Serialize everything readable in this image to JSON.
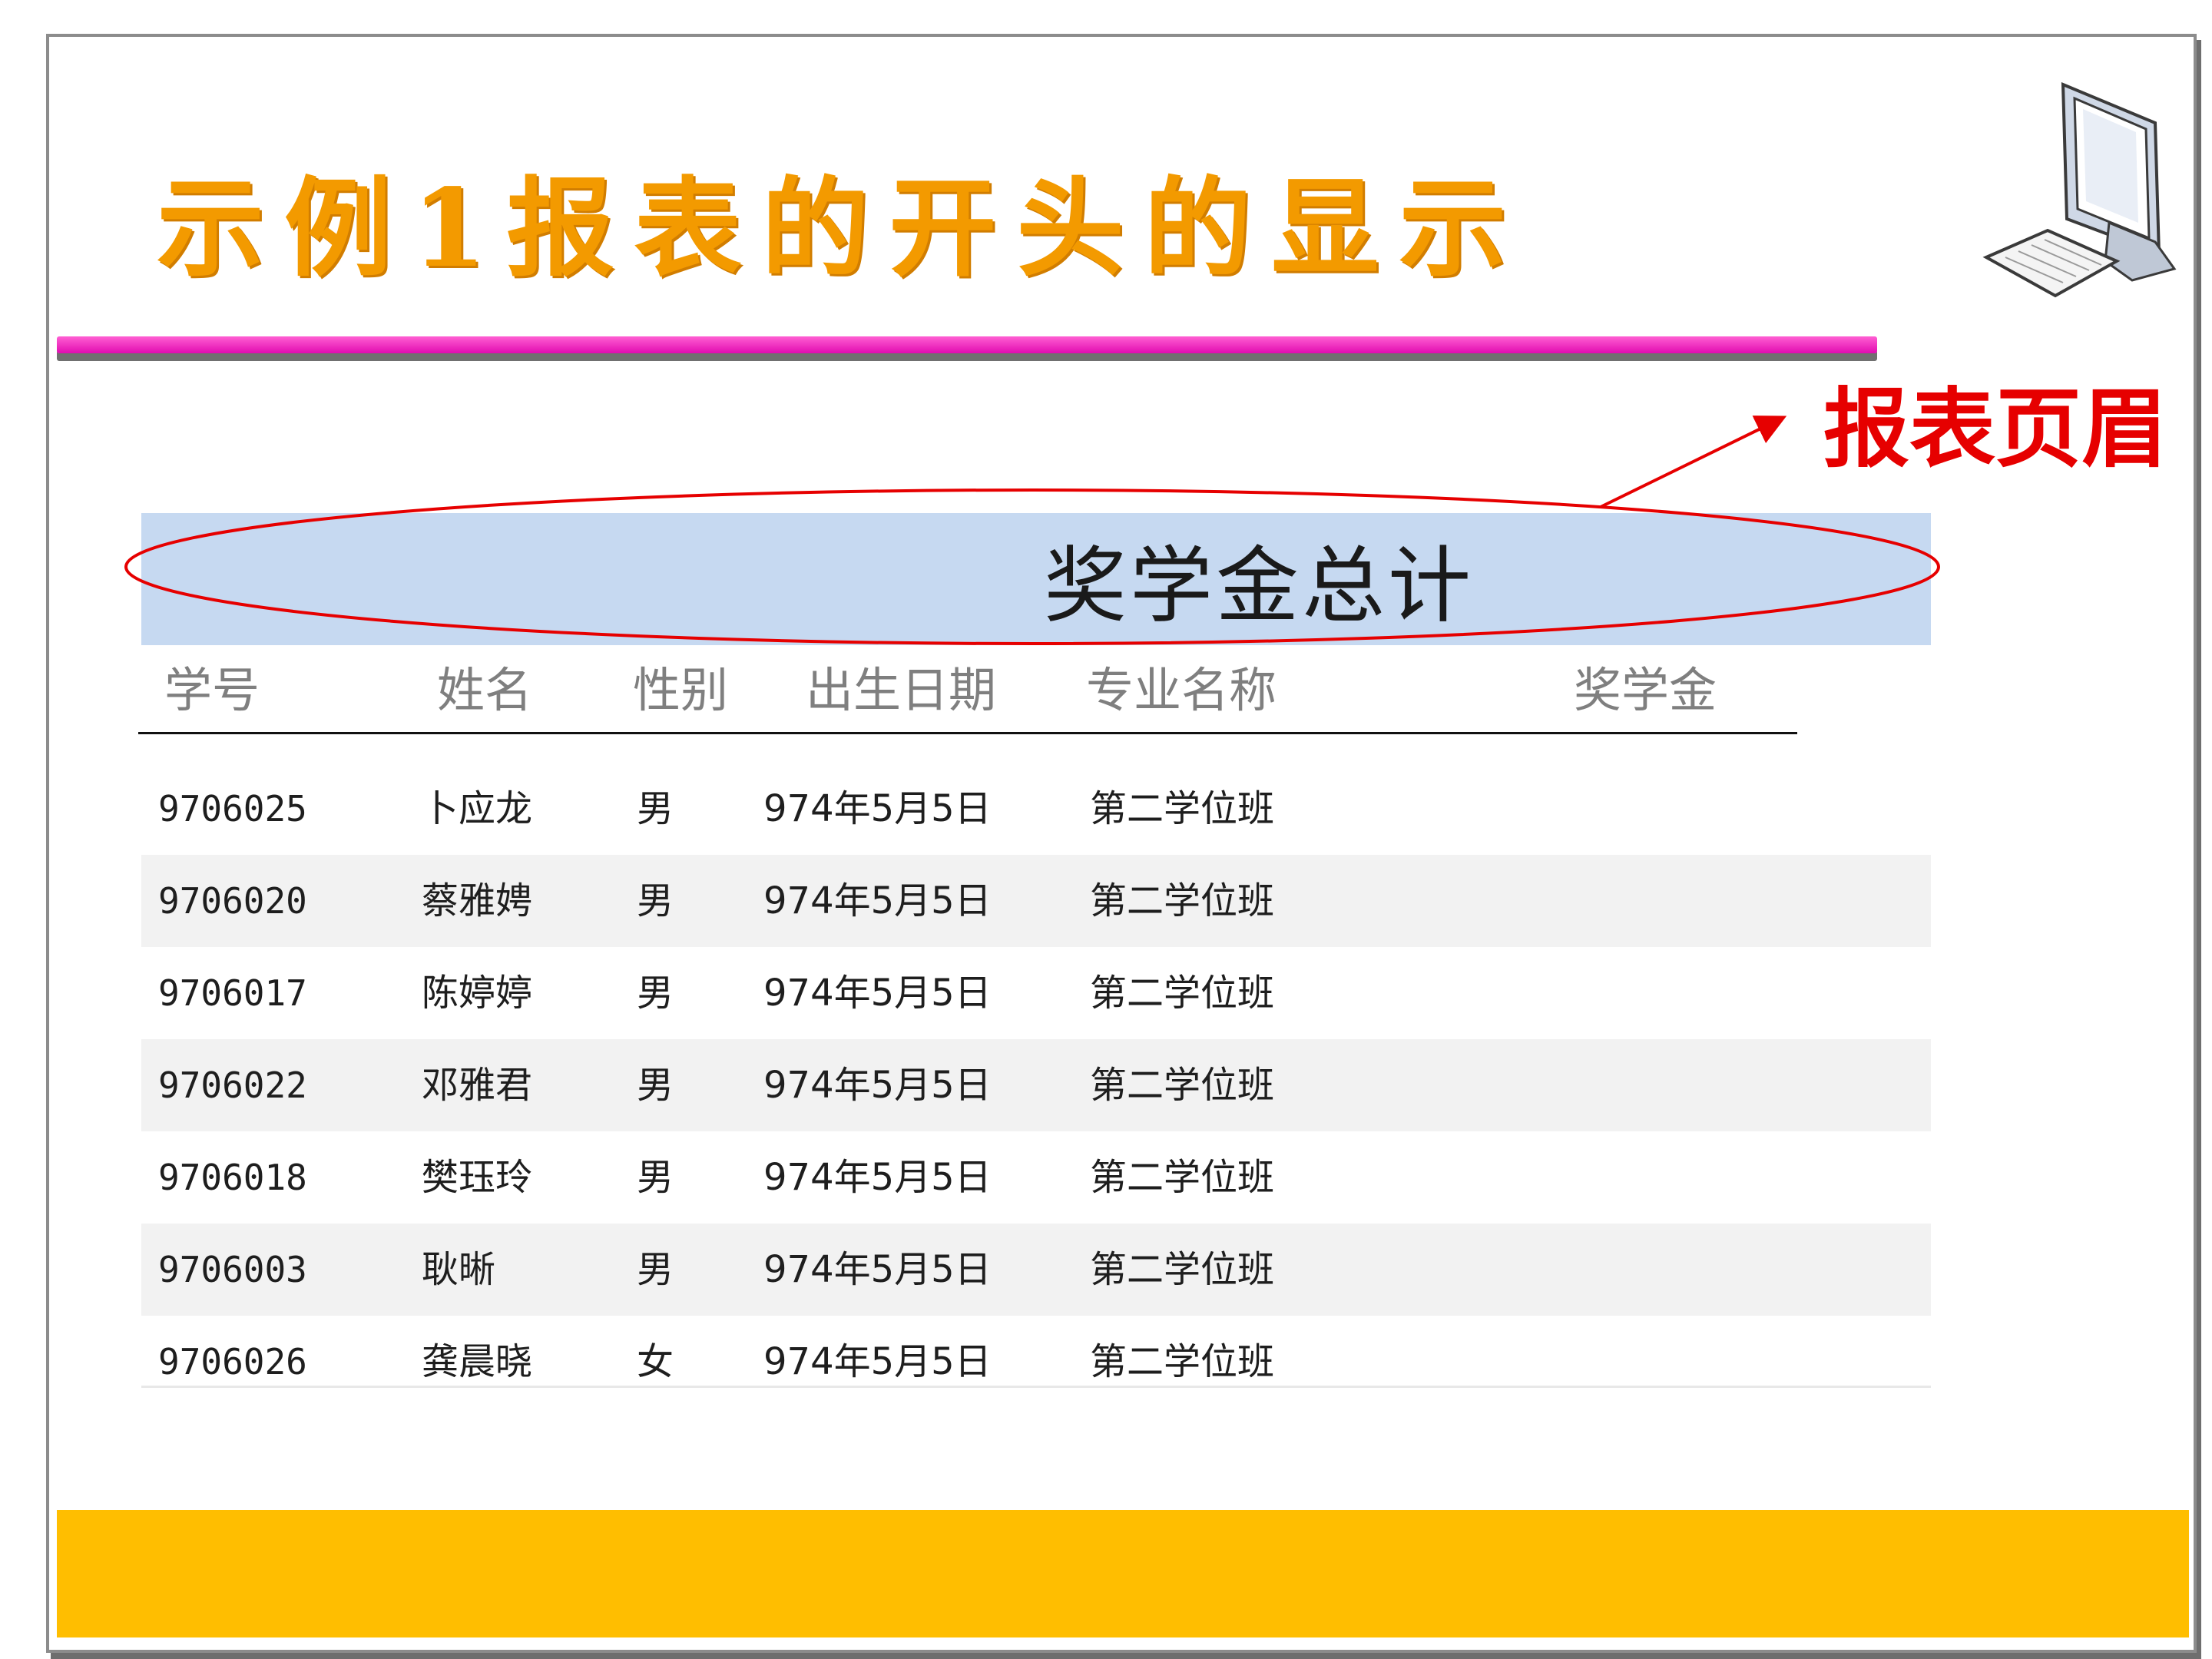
{
  "slide_title": "示例1报表的开头的显示",
  "annotation": {
    "label": "报表页眉",
    "color": "#e60000"
  },
  "report": {
    "title": "奖学金总计",
    "header_bg": "#c6d9f1",
    "columns": [
      "学号",
      "姓名",
      "性别",
      "出生日期",
      "专业名称",
      "奖学金"
    ],
    "rows": [
      [
        "9706025",
        "卜应龙",
        "男",
        "974年5月5日",
        "第二学位班",
        ""
      ],
      [
        "9706020",
        "蔡雅娉",
        "男",
        "974年5月5日",
        "第二学位班",
        ""
      ],
      [
        "9706017",
        "陈婷婷",
        "男",
        "974年5月5日",
        "第二学位班",
        ""
      ],
      [
        "9706022",
        "邓雅君",
        "男",
        "974年5月5日",
        "第二学位班",
        ""
      ],
      [
        "9706018",
        "樊珏玲",
        "男",
        "974年5月5日",
        "第二学位班",
        ""
      ],
      [
        "9706003",
        "耿晰",
        "男",
        "974年5月5日",
        "第二学位班",
        ""
      ],
      [
        "9706026",
        "龚晨晓",
        "女",
        "974年5月5日",
        "第二学位班",
        ""
      ]
    ]
  },
  "colors": {
    "title": "#F39A00",
    "title_bar": "#e10cb0",
    "footer_band": "#FFBE00",
    "row_alt": "#f2f2f2"
  },
  "icons": {
    "computer": "computer-icon"
  }
}
